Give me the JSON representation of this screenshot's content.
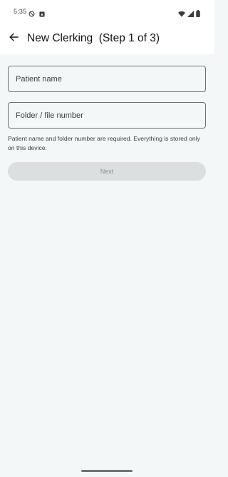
{
  "status_bar": {
    "time": "5:35",
    "left_icons": [
      "do-not-disturb-icon",
      "notification-icon"
    ],
    "right_icons": [
      "wifi-icon",
      "cell-signal-icon",
      "battery-icon"
    ]
  },
  "app_bar": {
    "back_icon": "arrow-back-icon",
    "title": "New Clerking  (Step 1 of 3)"
  },
  "form": {
    "patient_name": {
      "value": "",
      "placeholder": "Patient name"
    },
    "folder_number": {
      "value": "",
      "placeholder": "Folder / file number"
    },
    "helper_text": "Patient name and folder number are required. Everything is stored only on this device.",
    "next_label": "Next",
    "next_enabled": false
  },
  "colors": {
    "background": "#f4f7f7",
    "app_bar": "#ffffff",
    "field_border": "#6d7373",
    "button_disabled_bg": "#dadfe0",
    "button_disabled_text": "#8c9293"
  }
}
